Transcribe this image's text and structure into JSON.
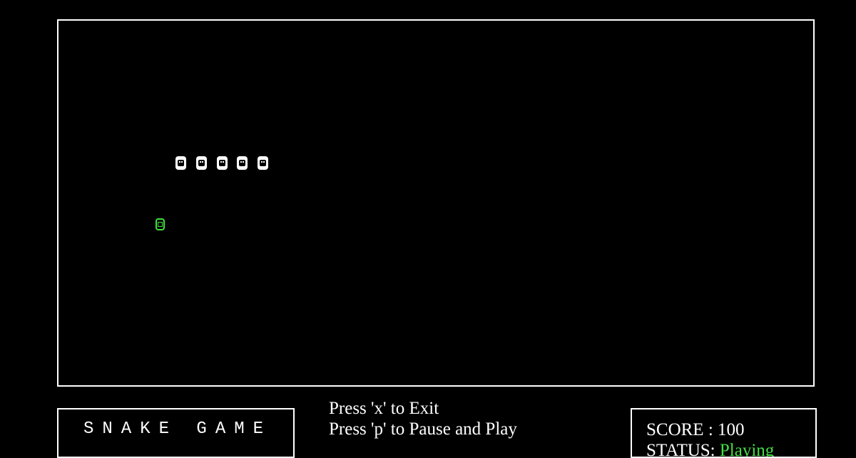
{
  "board": {
    "snake_segments": 5
  },
  "title": {
    "text": "SNAKE GAME"
  },
  "instructions": {
    "exit_line": "Press 'x' to Exit",
    "pause_line": "Press 'p' to Pause and Play"
  },
  "score_panel": {
    "score_label": "SCORE : ",
    "score_value": "100",
    "status_label": "STATUS: ",
    "status_value": "Playing"
  },
  "colors": {
    "background": "#000000",
    "foreground": "#ffffff",
    "food": "#44dd44",
    "status": "#44dd44"
  }
}
